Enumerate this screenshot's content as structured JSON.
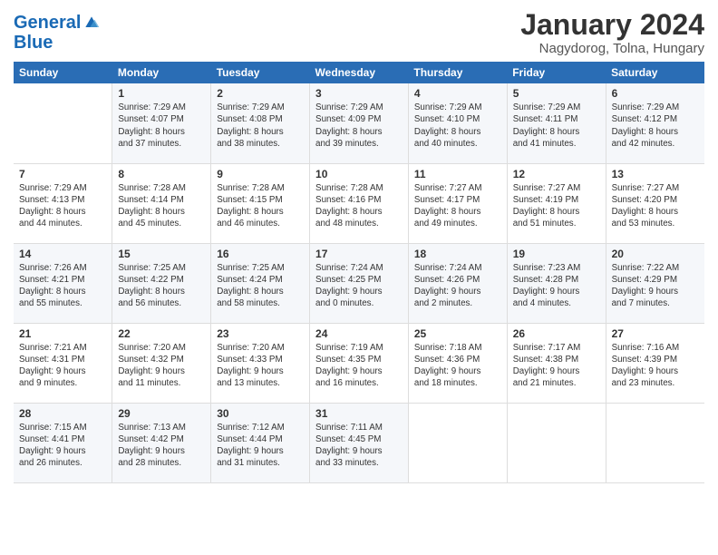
{
  "header": {
    "logo_line1": "General",
    "logo_line2": "Blue",
    "month": "January 2024",
    "location": "Nagydorog, Tolna, Hungary"
  },
  "weekdays": [
    "Sunday",
    "Monday",
    "Tuesday",
    "Wednesday",
    "Thursday",
    "Friday",
    "Saturday"
  ],
  "weeks": [
    [
      {
        "num": "",
        "info": ""
      },
      {
        "num": "1",
        "info": "Sunrise: 7:29 AM\nSunset: 4:07 PM\nDaylight: 8 hours\nand 37 minutes."
      },
      {
        "num": "2",
        "info": "Sunrise: 7:29 AM\nSunset: 4:08 PM\nDaylight: 8 hours\nand 38 minutes."
      },
      {
        "num": "3",
        "info": "Sunrise: 7:29 AM\nSunset: 4:09 PM\nDaylight: 8 hours\nand 39 minutes."
      },
      {
        "num": "4",
        "info": "Sunrise: 7:29 AM\nSunset: 4:10 PM\nDaylight: 8 hours\nand 40 minutes."
      },
      {
        "num": "5",
        "info": "Sunrise: 7:29 AM\nSunset: 4:11 PM\nDaylight: 8 hours\nand 41 minutes."
      },
      {
        "num": "6",
        "info": "Sunrise: 7:29 AM\nSunset: 4:12 PM\nDaylight: 8 hours\nand 42 minutes."
      }
    ],
    [
      {
        "num": "7",
        "info": "Sunrise: 7:29 AM\nSunset: 4:13 PM\nDaylight: 8 hours\nand 44 minutes."
      },
      {
        "num": "8",
        "info": "Sunrise: 7:28 AM\nSunset: 4:14 PM\nDaylight: 8 hours\nand 45 minutes."
      },
      {
        "num": "9",
        "info": "Sunrise: 7:28 AM\nSunset: 4:15 PM\nDaylight: 8 hours\nand 46 minutes."
      },
      {
        "num": "10",
        "info": "Sunrise: 7:28 AM\nSunset: 4:16 PM\nDaylight: 8 hours\nand 48 minutes."
      },
      {
        "num": "11",
        "info": "Sunrise: 7:27 AM\nSunset: 4:17 PM\nDaylight: 8 hours\nand 49 minutes."
      },
      {
        "num": "12",
        "info": "Sunrise: 7:27 AM\nSunset: 4:19 PM\nDaylight: 8 hours\nand 51 minutes."
      },
      {
        "num": "13",
        "info": "Sunrise: 7:27 AM\nSunset: 4:20 PM\nDaylight: 8 hours\nand 53 minutes."
      }
    ],
    [
      {
        "num": "14",
        "info": "Sunrise: 7:26 AM\nSunset: 4:21 PM\nDaylight: 8 hours\nand 55 minutes."
      },
      {
        "num": "15",
        "info": "Sunrise: 7:25 AM\nSunset: 4:22 PM\nDaylight: 8 hours\nand 56 minutes."
      },
      {
        "num": "16",
        "info": "Sunrise: 7:25 AM\nSunset: 4:24 PM\nDaylight: 8 hours\nand 58 minutes."
      },
      {
        "num": "17",
        "info": "Sunrise: 7:24 AM\nSunset: 4:25 PM\nDaylight: 9 hours\nand 0 minutes."
      },
      {
        "num": "18",
        "info": "Sunrise: 7:24 AM\nSunset: 4:26 PM\nDaylight: 9 hours\nand 2 minutes."
      },
      {
        "num": "19",
        "info": "Sunrise: 7:23 AM\nSunset: 4:28 PM\nDaylight: 9 hours\nand 4 minutes."
      },
      {
        "num": "20",
        "info": "Sunrise: 7:22 AM\nSunset: 4:29 PM\nDaylight: 9 hours\nand 7 minutes."
      }
    ],
    [
      {
        "num": "21",
        "info": "Sunrise: 7:21 AM\nSunset: 4:31 PM\nDaylight: 9 hours\nand 9 minutes."
      },
      {
        "num": "22",
        "info": "Sunrise: 7:20 AM\nSunset: 4:32 PM\nDaylight: 9 hours\nand 11 minutes."
      },
      {
        "num": "23",
        "info": "Sunrise: 7:20 AM\nSunset: 4:33 PM\nDaylight: 9 hours\nand 13 minutes."
      },
      {
        "num": "24",
        "info": "Sunrise: 7:19 AM\nSunset: 4:35 PM\nDaylight: 9 hours\nand 16 minutes."
      },
      {
        "num": "25",
        "info": "Sunrise: 7:18 AM\nSunset: 4:36 PM\nDaylight: 9 hours\nand 18 minutes."
      },
      {
        "num": "26",
        "info": "Sunrise: 7:17 AM\nSunset: 4:38 PM\nDaylight: 9 hours\nand 21 minutes."
      },
      {
        "num": "27",
        "info": "Sunrise: 7:16 AM\nSunset: 4:39 PM\nDaylight: 9 hours\nand 23 minutes."
      }
    ],
    [
      {
        "num": "28",
        "info": "Sunrise: 7:15 AM\nSunset: 4:41 PM\nDaylight: 9 hours\nand 26 minutes."
      },
      {
        "num": "29",
        "info": "Sunrise: 7:13 AM\nSunset: 4:42 PM\nDaylight: 9 hours\nand 28 minutes."
      },
      {
        "num": "30",
        "info": "Sunrise: 7:12 AM\nSunset: 4:44 PM\nDaylight: 9 hours\nand 31 minutes."
      },
      {
        "num": "31",
        "info": "Sunrise: 7:11 AM\nSunset: 4:45 PM\nDaylight: 9 hours\nand 33 minutes."
      },
      {
        "num": "",
        "info": ""
      },
      {
        "num": "",
        "info": ""
      },
      {
        "num": "",
        "info": ""
      }
    ]
  ]
}
